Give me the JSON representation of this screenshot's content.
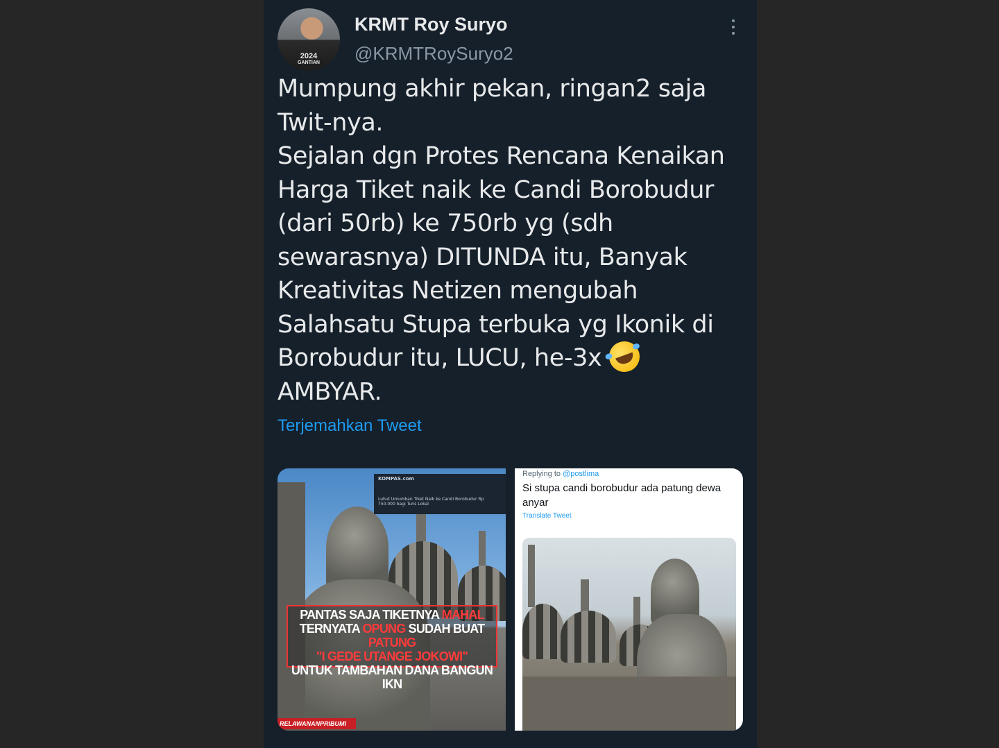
{
  "tweet": {
    "display_name": "KRMT Roy Suryo",
    "handle": "@KRMTRoySuryo2",
    "avatar_shirt_text": [
      "2024",
      "GANTIAN"
    ],
    "text_lines": [
      "Mumpung akhir pekan, ringan2 saja",
      "Twit-nya.",
      "Sejalan dgn Protes Rencana Kenaikan",
      "Harga Tiket naik ke Candi Borobudur",
      "(dari 50rb) ke 750rb yg (sdh",
      "sewarasnya) DITUNDA itu, Banyak",
      "Kreativitas Netizen mengubah",
      "Salahsatu Stupa terbuka yg Ikonik di",
      "Borobudur itu, LUCU, he-3x",
      "AMBYAR."
    ],
    "emoji": "rolling-on-the-floor-laughing",
    "translate_label": "Terjemahkan Tweet"
  },
  "media": {
    "left": {
      "news_site": "KOMPAS.com",
      "news_headline": "Luhut Umumkan Tiket Naik ke Candi Borobudur Rp 750.000 bagi Turis Lokal",
      "banner_parts": {
        "l1a": "PANTAS SAJA TIKETNYA ",
        "l1b": "MAHAL",
        "l2a": "TERNYATA ",
        "l2b": "OPUNG",
        "l2c": " SUDAH BUAT ",
        "l2d": "PATUNG",
        "l3": "\"I GEDE UTANGE JOKOWI\"",
        "l4": "UNTUK TAMBAHAN DANA BANGUN IKN"
      },
      "watermark": "RELAWANANPRIBUMI"
    },
    "right": {
      "reply_prefix": "Replying to ",
      "reply_mention": "@postlima",
      "text": "Si stupa candi borobudur ada patung dewa anyar",
      "translate_label": "Translate Tweet"
    }
  },
  "colors": {
    "background": "#262626",
    "card": "#16202b",
    "text": "#e7e9ea",
    "muted": "#8b98a5",
    "link": "#1d9bf0"
  }
}
